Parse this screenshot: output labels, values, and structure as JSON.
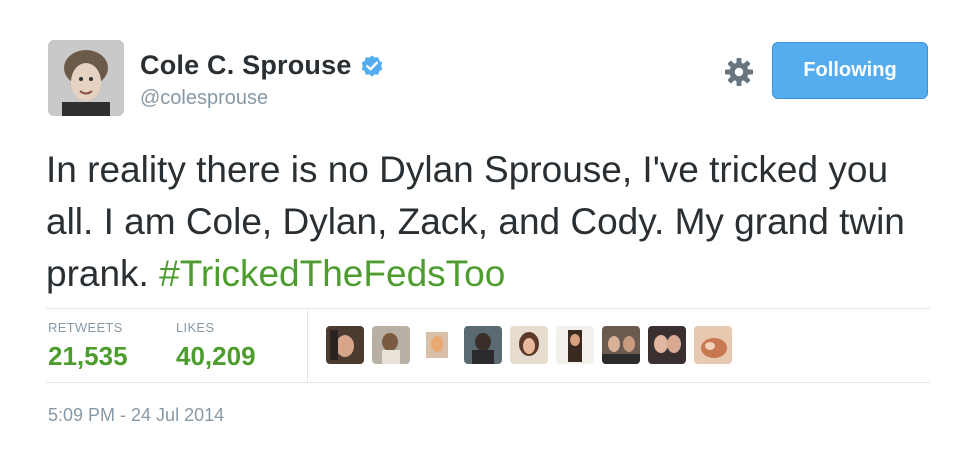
{
  "author": {
    "display_name": "Cole C. Sprouse",
    "handle": "@colesprouse",
    "verified": true
  },
  "actions": {
    "follow_label": "Following",
    "gear_icon": "gear-icon"
  },
  "tweet": {
    "text": "In reality there is no Dylan Sprouse, I've tricked you all. I am Cole, Dylan, Zack, and Cody. My grand twin prank. ",
    "hashtag": "#TrickedTheFedsToo"
  },
  "stats": {
    "retweets_label": "RETWEETS",
    "retweets_value": "21,535",
    "likes_label": "LIKES",
    "likes_value": "40,209"
  },
  "likers": [
    {
      "icon": "liker-avatar"
    },
    {
      "icon": "liker-avatar"
    },
    {
      "icon": "liker-avatar"
    },
    {
      "icon": "liker-avatar"
    },
    {
      "icon": "liker-avatar"
    },
    {
      "icon": "liker-avatar"
    },
    {
      "icon": "liker-avatar"
    },
    {
      "icon": "liker-avatar"
    },
    {
      "icon": "liker-avatar"
    }
  ],
  "timestamp": "5:09 PM - 24 Jul 2014",
  "colors": {
    "accent_blue": "#55acee",
    "hashtag_green": "#4c9c2e",
    "muted_gray": "#8899a6",
    "verified_blue": "#55acee"
  }
}
